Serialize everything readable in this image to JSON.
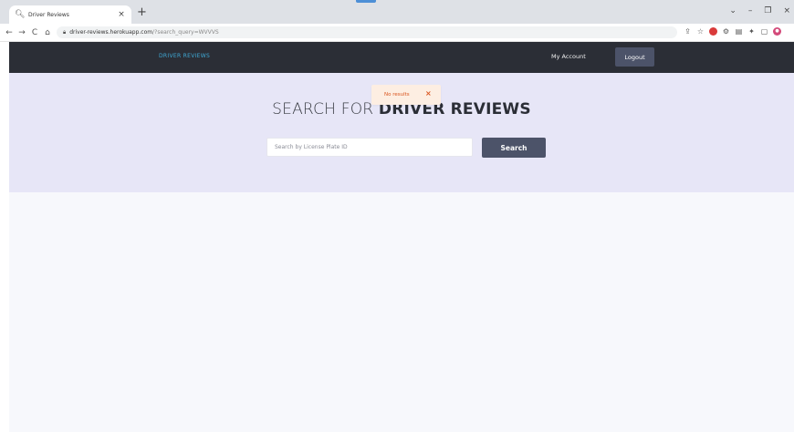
{
  "browser": {
    "tab_title": "Driver Reviews",
    "tab_close": "×",
    "new_tab": "+",
    "window_controls": [
      "⌄",
      "–",
      "❐",
      "×"
    ],
    "nav": [
      "←",
      "→",
      "C",
      "⌂"
    ],
    "url_host": "driver-reviews.herokuapp.com",
    "url_path": "/?search_query=WVVVS",
    "extensions": [
      "share-icon",
      "star-icon",
      "red-extension-icon",
      "tools-icon",
      "reader-icon",
      "puzzle-icon",
      "sidebar-icon",
      "profile-avatar"
    ]
  },
  "navbar": {
    "brand": "DRIVER REVIEWS",
    "my_account": "My Account",
    "logout": "Logout"
  },
  "hero": {
    "title_thin": "SEARCH FOR ",
    "title_bold": "DRIVER REVIEWS",
    "search_placeholder": "Search by License Plate ID",
    "search_button": "Search"
  },
  "toast": {
    "message": "No results",
    "close": "×"
  },
  "colors": {
    "navbar_bg": "#2b2e36",
    "brand": "#3fa9d6",
    "button_bg": "#4c5369",
    "hero_bg": "#e7e6f7",
    "toast_bg": "#fdeee2",
    "toast_text": "#d9541e"
  }
}
